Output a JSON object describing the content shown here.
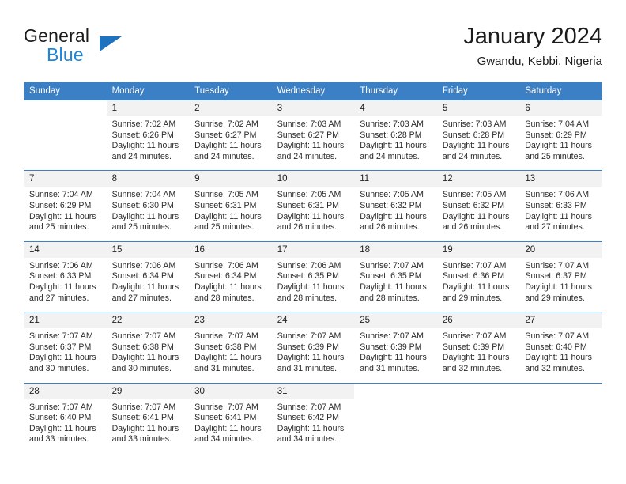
{
  "brand": {
    "line1": "General",
    "line2": "Blue",
    "triangle_color": "#1f72bd",
    "blue_color": "#1f86d8"
  },
  "header": {
    "title": "January 2024",
    "location": "Gwandu, Kebbi, Nigeria"
  },
  "theme": {
    "header_bg": "#3b7fc4",
    "daynum_bg": "#f2f2f2",
    "row_border": "#3b7fc4"
  },
  "weekday_headers": [
    "Sunday",
    "Monday",
    "Tuesday",
    "Wednesday",
    "Thursday",
    "Friday",
    "Saturday"
  ],
  "weeks": [
    [
      {
        "day": "",
        "sunrise": "",
        "sunset": "",
        "daylight1": "",
        "daylight2": "",
        "blank": true
      },
      {
        "day": "1",
        "sunrise": "Sunrise: 7:02 AM",
        "sunset": "Sunset: 6:26 PM",
        "daylight1": "Daylight: 11 hours",
        "daylight2": "and 24 minutes."
      },
      {
        "day": "2",
        "sunrise": "Sunrise: 7:02 AM",
        "sunset": "Sunset: 6:27 PM",
        "daylight1": "Daylight: 11 hours",
        "daylight2": "and 24 minutes."
      },
      {
        "day": "3",
        "sunrise": "Sunrise: 7:03 AM",
        "sunset": "Sunset: 6:27 PM",
        "daylight1": "Daylight: 11 hours",
        "daylight2": "and 24 minutes."
      },
      {
        "day": "4",
        "sunrise": "Sunrise: 7:03 AM",
        "sunset": "Sunset: 6:28 PM",
        "daylight1": "Daylight: 11 hours",
        "daylight2": "and 24 minutes."
      },
      {
        "day": "5",
        "sunrise": "Sunrise: 7:03 AM",
        "sunset": "Sunset: 6:28 PM",
        "daylight1": "Daylight: 11 hours",
        "daylight2": "and 24 minutes."
      },
      {
        "day": "6",
        "sunrise": "Sunrise: 7:04 AM",
        "sunset": "Sunset: 6:29 PM",
        "daylight1": "Daylight: 11 hours",
        "daylight2": "and 25 minutes."
      }
    ],
    [
      {
        "day": "7",
        "sunrise": "Sunrise: 7:04 AM",
        "sunset": "Sunset: 6:29 PM",
        "daylight1": "Daylight: 11 hours",
        "daylight2": "and 25 minutes."
      },
      {
        "day": "8",
        "sunrise": "Sunrise: 7:04 AM",
        "sunset": "Sunset: 6:30 PM",
        "daylight1": "Daylight: 11 hours",
        "daylight2": "and 25 minutes."
      },
      {
        "day": "9",
        "sunrise": "Sunrise: 7:05 AM",
        "sunset": "Sunset: 6:31 PM",
        "daylight1": "Daylight: 11 hours",
        "daylight2": "and 25 minutes."
      },
      {
        "day": "10",
        "sunrise": "Sunrise: 7:05 AM",
        "sunset": "Sunset: 6:31 PM",
        "daylight1": "Daylight: 11 hours",
        "daylight2": "and 26 minutes."
      },
      {
        "day": "11",
        "sunrise": "Sunrise: 7:05 AM",
        "sunset": "Sunset: 6:32 PM",
        "daylight1": "Daylight: 11 hours",
        "daylight2": "and 26 minutes."
      },
      {
        "day": "12",
        "sunrise": "Sunrise: 7:05 AM",
        "sunset": "Sunset: 6:32 PM",
        "daylight1": "Daylight: 11 hours",
        "daylight2": "and 26 minutes."
      },
      {
        "day": "13",
        "sunrise": "Sunrise: 7:06 AM",
        "sunset": "Sunset: 6:33 PM",
        "daylight1": "Daylight: 11 hours",
        "daylight2": "and 27 minutes."
      }
    ],
    [
      {
        "day": "14",
        "sunrise": "Sunrise: 7:06 AM",
        "sunset": "Sunset: 6:33 PM",
        "daylight1": "Daylight: 11 hours",
        "daylight2": "and 27 minutes."
      },
      {
        "day": "15",
        "sunrise": "Sunrise: 7:06 AM",
        "sunset": "Sunset: 6:34 PM",
        "daylight1": "Daylight: 11 hours",
        "daylight2": "and 27 minutes."
      },
      {
        "day": "16",
        "sunrise": "Sunrise: 7:06 AM",
        "sunset": "Sunset: 6:34 PM",
        "daylight1": "Daylight: 11 hours",
        "daylight2": "and 28 minutes."
      },
      {
        "day": "17",
        "sunrise": "Sunrise: 7:06 AM",
        "sunset": "Sunset: 6:35 PM",
        "daylight1": "Daylight: 11 hours",
        "daylight2": "and 28 minutes."
      },
      {
        "day": "18",
        "sunrise": "Sunrise: 7:07 AM",
        "sunset": "Sunset: 6:35 PM",
        "daylight1": "Daylight: 11 hours",
        "daylight2": "and 28 minutes."
      },
      {
        "day": "19",
        "sunrise": "Sunrise: 7:07 AM",
        "sunset": "Sunset: 6:36 PM",
        "daylight1": "Daylight: 11 hours",
        "daylight2": "and 29 minutes."
      },
      {
        "day": "20",
        "sunrise": "Sunrise: 7:07 AM",
        "sunset": "Sunset: 6:37 PM",
        "daylight1": "Daylight: 11 hours",
        "daylight2": "and 29 minutes."
      }
    ],
    [
      {
        "day": "21",
        "sunrise": "Sunrise: 7:07 AM",
        "sunset": "Sunset: 6:37 PM",
        "daylight1": "Daylight: 11 hours",
        "daylight2": "and 30 minutes."
      },
      {
        "day": "22",
        "sunrise": "Sunrise: 7:07 AM",
        "sunset": "Sunset: 6:38 PM",
        "daylight1": "Daylight: 11 hours",
        "daylight2": "and 30 minutes."
      },
      {
        "day": "23",
        "sunrise": "Sunrise: 7:07 AM",
        "sunset": "Sunset: 6:38 PM",
        "daylight1": "Daylight: 11 hours",
        "daylight2": "and 31 minutes."
      },
      {
        "day": "24",
        "sunrise": "Sunrise: 7:07 AM",
        "sunset": "Sunset: 6:39 PM",
        "daylight1": "Daylight: 11 hours",
        "daylight2": "and 31 minutes."
      },
      {
        "day": "25",
        "sunrise": "Sunrise: 7:07 AM",
        "sunset": "Sunset: 6:39 PM",
        "daylight1": "Daylight: 11 hours",
        "daylight2": "and 31 minutes."
      },
      {
        "day": "26",
        "sunrise": "Sunrise: 7:07 AM",
        "sunset": "Sunset: 6:39 PM",
        "daylight1": "Daylight: 11 hours",
        "daylight2": "and 32 minutes."
      },
      {
        "day": "27",
        "sunrise": "Sunrise: 7:07 AM",
        "sunset": "Sunset: 6:40 PM",
        "daylight1": "Daylight: 11 hours",
        "daylight2": "and 32 minutes."
      }
    ],
    [
      {
        "day": "28",
        "sunrise": "Sunrise: 7:07 AM",
        "sunset": "Sunset: 6:40 PM",
        "daylight1": "Daylight: 11 hours",
        "daylight2": "and 33 minutes."
      },
      {
        "day": "29",
        "sunrise": "Sunrise: 7:07 AM",
        "sunset": "Sunset: 6:41 PM",
        "daylight1": "Daylight: 11 hours",
        "daylight2": "and 33 minutes."
      },
      {
        "day": "30",
        "sunrise": "Sunrise: 7:07 AM",
        "sunset": "Sunset: 6:41 PM",
        "daylight1": "Daylight: 11 hours",
        "daylight2": "and 34 minutes."
      },
      {
        "day": "31",
        "sunrise": "Sunrise: 7:07 AM",
        "sunset": "Sunset: 6:42 PM",
        "daylight1": "Daylight: 11 hours",
        "daylight2": "and 34 minutes."
      },
      {
        "day": "",
        "sunrise": "",
        "sunset": "",
        "daylight1": "",
        "daylight2": "",
        "blank": true
      },
      {
        "day": "",
        "sunrise": "",
        "sunset": "",
        "daylight1": "",
        "daylight2": "",
        "blank": true
      },
      {
        "day": "",
        "sunrise": "",
        "sunset": "",
        "daylight1": "",
        "daylight2": "",
        "blank": true
      }
    ]
  ]
}
